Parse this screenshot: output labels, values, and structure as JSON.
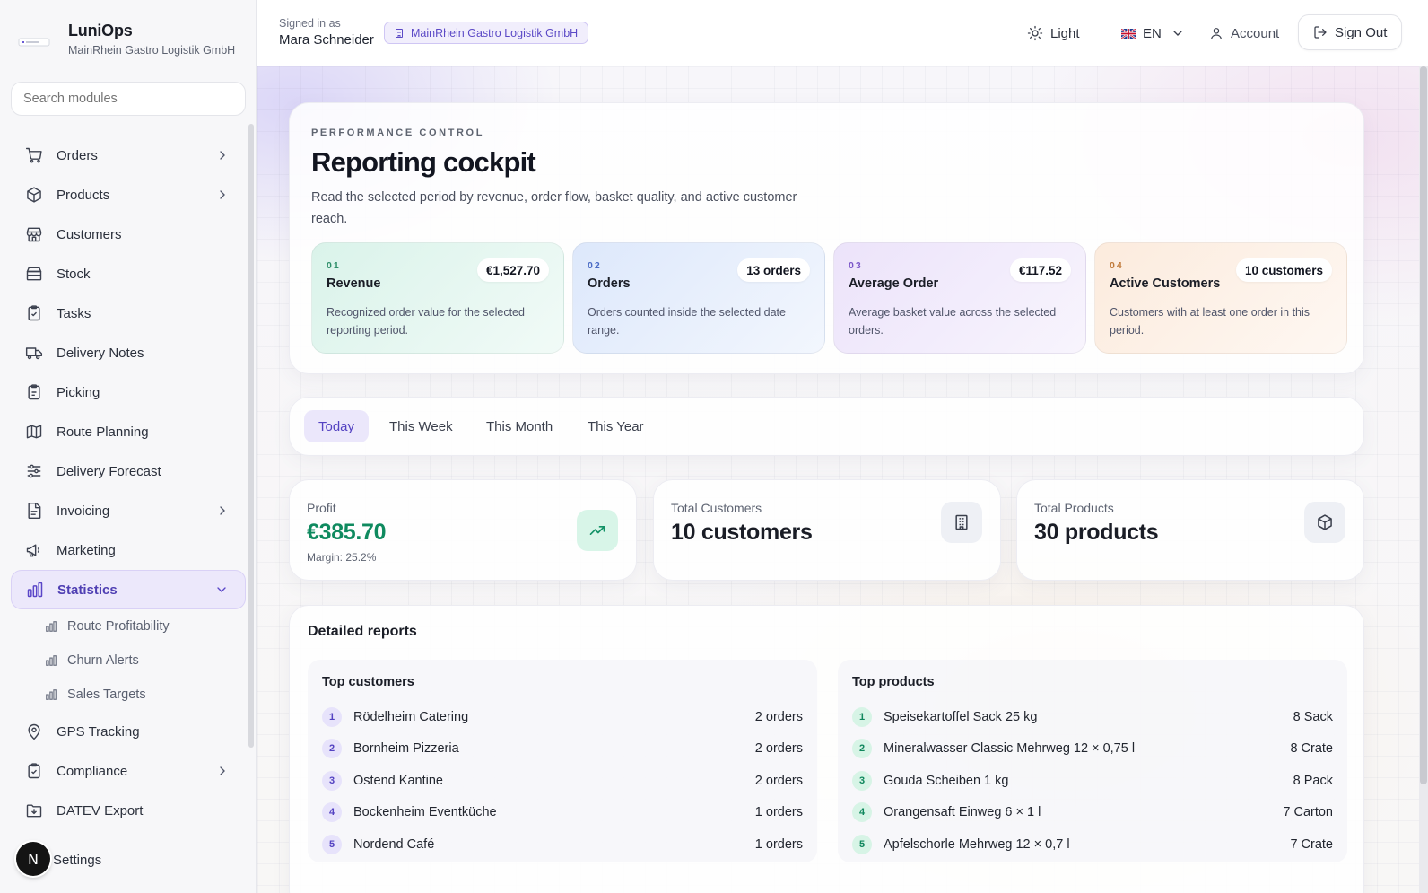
{
  "brand": {
    "name": "LuniOps",
    "company": "MainRhein Gastro Logistik GmbH"
  },
  "search": {
    "placeholder": "Search modules"
  },
  "nav": {
    "items": [
      {
        "label": "Orders"
      },
      {
        "label": "Products"
      },
      {
        "label": "Customers"
      },
      {
        "label": "Stock"
      },
      {
        "label": "Tasks"
      },
      {
        "label": "Delivery Notes"
      },
      {
        "label": "Picking"
      },
      {
        "label": "Route Planning"
      },
      {
        "label": "Delivery Forecast"
      },
      {
        "label": "Invoicing"
      },
      {
        "label": "Marketing"
      },
      {
        "label": "Statistics"
      },
      {
        "label": "GPS Tracking"
      },
      {
        "label": "Compliance"
      },
      {
        "label": "DATEV Export"
      }
    ],
    "statistics_sub": [
      {
        "label": "Route Profitability"
      },
      {
        "label": "Churn Alerts"
      },
      {
        "label": "Sales Targets"
      }
    ],
    "settings": "Settings",
    "avatar_letter": "N"
  },
  "header": {
    "signed_in_label": "Signed in as",
    "user_name": "Mara Schneider",
    "org_badge": "MainRhein Gastro Logistik GmbH",
    "theme_label": "Light",
    "language": "EN",
    "account_label": "Account",
    "signout_label": "Sign Out"
  },
  "hero": {
    "eyebrow": "PERFORMANCE CONTROL",
    "title": "Reporting cockpit",
    "description": "Read the selected period by revenue, order flow, basket quality, and active customer reach.",
    "kpis": [
      {
        "num": "01",
        "name": "Revenue",
        "value": "€1,527.70",
        "desc": "Recognized order value for the selected reporting period.",
        "bg": "#daf3ea",
        "accent": "#2f8f6a"
      },
      {
        "num": "02",
        "name": "Orders",
        "value": "13 orders",
        "desc": "Orders counted inside the selected date range.",
        "bg": "#dde8fb",
        "accent": "#4a6bc5"
      },
      {
        "num": "03",
        "name": "Average Order",
        "value": "€117.52",
        "desc": "Average basket value across the selected orders.",
        "bg": "#ece3fa",
        "accent": "#7a55c8"
      },
      {
        "num": "04",
        "name": "Active Customers",
        "value": "10 customers",
        "desc": "Customers with at least one order in this period.",
        "bg": "#fcebdd",
        "accent": "#c07a3a"
      }
    ]
  },
  "tabs": [
    {
      "label": "Today"
    },
    {
      "label": "This Week"
    },
    {
      "label": "This Month"
    },
    {
      "label": "This Year"
    }
  ],
  "stats": {
    "profit": {
      "label": "Profit",
      "value": "€385.70",
      "sub": "Margin: 25.2%"
    },
    "customers": {
      "label": "Total Customers",
      "value": "10 customers"
    },
    "products": {
      "label": "Total Products",
      "value": "30 products"
    }
  },
  "reports": {
    "title": "Detailed reports",
    "top_customers": {
      "title": "Top customers",
      "rows": [
        {
          "rank": "1",
          "name": "Rödelheim Catering",
          "value": "2 orders"
        },
        {
          "rank": "2",
          "name": "Bornheim Pizzeria",
          "value": "2 orders"
        },
        {
          "rank": "3",
          "name": "Ostend Kantine",
          "value": "2 orders"
        },
        {
          "rank": "4",
          "name": "Bockenheim Eventküche",
          "value": "1 orders"
        },
        {
          "rank": "5",
          "name": "Nordend Café",
          "value": "1 orders"
        }
      ]
    },
    "top_products": {
      "title": "Top products",
      "rows": [
        {
          "rank": "1",
          "name": "Speisekartoffel Sack 25 kg",
          "value": "8 Sack"
        },
        {
          "rank": "2",
          "name": "Mineralwasser Classic Mehrweg 12 × 0,75 l",
          "value": "8 Crate"
        },
        {
          "rank": "3",
          "name": "Gouda Scheiben 1 kg",
          "value": "8 Pack"
        },
        {
          "rank": "4",
          "name": "Orangensaft Einweg 6 × 1 l",
          "value": "7 Carton"
        },
        {
          "rank": "5",
          "name": "Apfelschorle Mehrweg 12 × 0,7 l",
          "value": "7 Crate"
        }
      ]
    }
  }
}
